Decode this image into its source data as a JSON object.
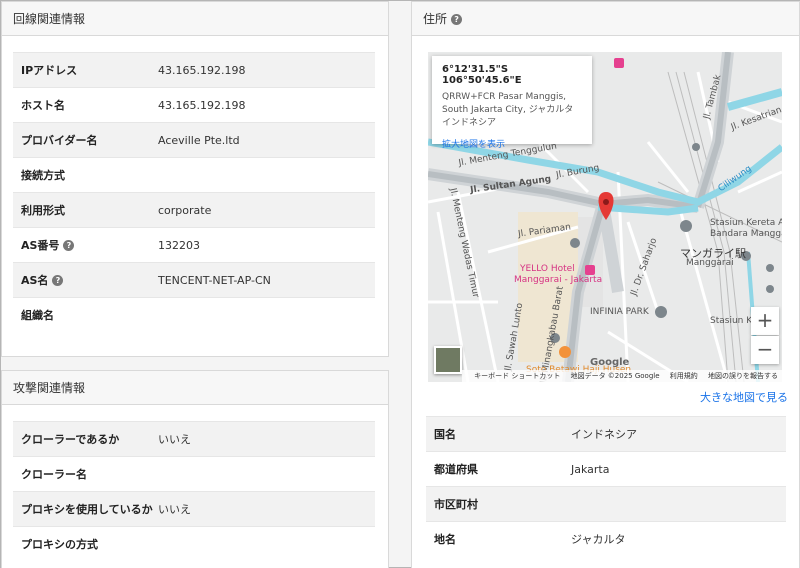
{
  "line_panel": {
    "title": "回線関連情報",
    "rows": [
      {
        "key": "IPアドレス",
        "value": "43.165.192.198",
        "help": false
      },
      {
        "key": "ホスト名",
        "value": "43.165.192.198",
        "help": false
      },
      {
        "key": "プロバイダー名",
        "value": "Aceville Pte.ltd",
        "help": false
      },
      {
        "key": "接続方式",
        "value": "",
        "help": false
      },
      {
        "key": "利用形式",
        "value": "corporate",
        "help": false
      },
      {
        "key": "AS番号",
        "value": "132203",
        "help": true
      },
      {
        "key": "AS名",
        "value": "TENCENT-NET-AP-CN",
        "help": true
      },
      {
        "key": "組織名",
        "value": "",
        "help": false
      }
    ]
  },
  "attack_panel": {
    "title": "攻撃関連情報",
    "rows": [
      {
        "key": "クローラーであるか",
        "value": "いいえ"
      },
      {
        "key": "クローラー名",
        "value": ""
      },
      {
        "key": "プロキシを使用しているか",
        "value": "いいえ"
      },
      {
        "key": "プロキシの方式",
        "value": ""
      }
    ]
  },
  "address_panel": {
    "title": "住所",
    "map": {
      "coords": "6°12'31.5\"S 106°50'45.6\"E",
      "address": "QRRW+FCR Pasar Manggis, South Jakarta City, ジャカルタ インドネシア",
      "enlarge_link": "拡大地図を表示",
      "zoom_in": "+",
      "zoom_out": "−",
      "google": "Google",
      "attribution": [
        "キーボード ショートカット",
        "地図データ ©2025 Google",
        "利用規約",
        "地図の誤りを報告する"
      ],
      "labels": {
        "sultan_agung": "Jl. Sultan Agung",
        "pariaman": "Jl. Pariaman",
        "yello": "YELLO Hotel",
        "yello2": "Manggarai - Jakarta",
        "infinia": "INFINIA PARK",
        "manggarai": "マンガライ駅",
        "manggarai2": "Manggarai",
        "stasiun": "Stasiun Kereta Api",
        "stasiun2": "Bandara Manggarai",
        "ciliwung": "Ciliwung",
        "soto": "Soto Betawi Haji Husen",
        "tambak": "Jl. Tambak",
        "kesatrian": "Jl. Kesatrian",
        "menteng_tenggulun": "Jl. Menteng Tenggulun",
        "saharjo": "Jl. Dr. Saharjo",
        "sawah_lunto": "Jl. Sawah Lunto",
        "minangkabau": "Jl. Minangkabau Barat",
        "menteng_wadas": "Jl. Menteng Wadas Timur",
        "burung": "Jl. Burung",
        "stasiun_kereta": "Stasiun Kereta"
      }
    },
    "big_map_link": "大きな地図で見る",
    "rows": [
      {
        "key": "国名",
        "value": "インドネシア"
      },
      {
        "key": "都道府県",
        "value": "Jakarta"
      },
      {
        "key": "市区町村",
        "value": ""
      },
      {
        "key": "地名",
        "value": "ジャカルタ"
      }
    ]
  }
}
